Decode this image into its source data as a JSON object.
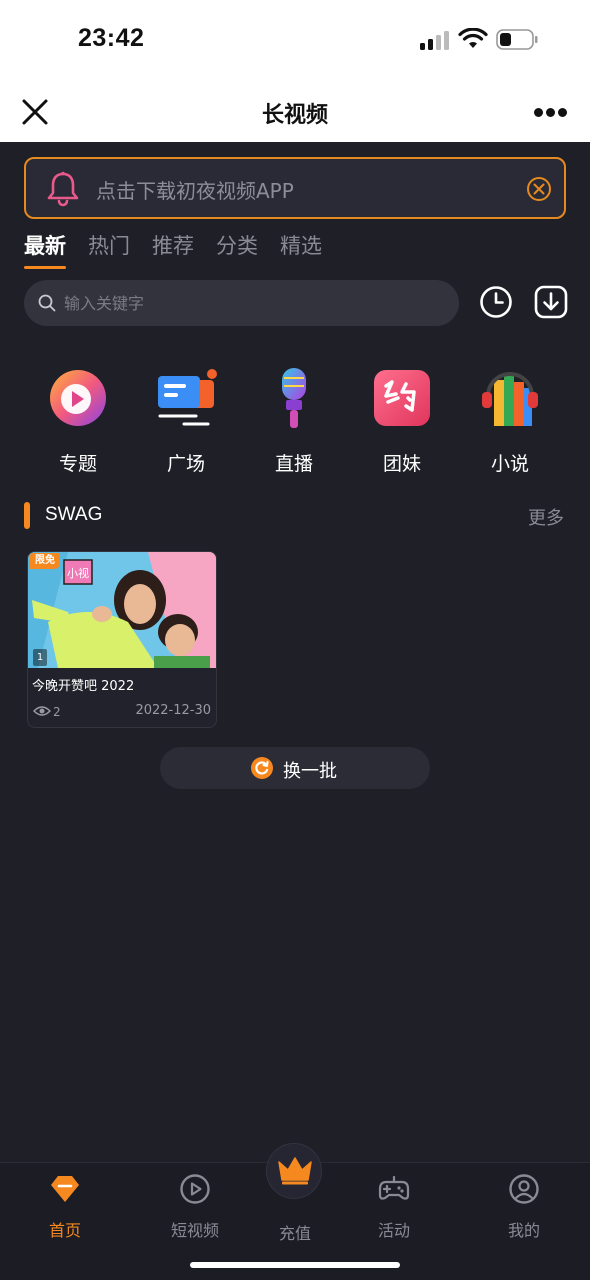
{
  "status_bar": {
    "time": "23:42"
  },
  "navbar": {
    "title": "长视频"
  },
  "banner": {
    "text": "点击下载初夜视频APP"
  },
  "tabs": [
    {
      "label": "最新",
      "active": true
    },
    {
      "label": "热门",
      "active": false
    },
    {
      "label": "推荐",
      "active": false
    },
    {
      "label": "分类",
      "active": false
    },
    {
      "label": "精选",
      "active": false
    }
  ],
  "search": {
    "placeholder": "输入关键字"
  },
  "categories": [
    {
      "label": "专题",
      "icon": "topic-icon"
    },
    {
      "label": "广场",
      "icon": "square-icon"
    },
    {
      "label": "直播",
      "icon": "microphone-icon"
    },
    {
      "label": "团妹",
      "icon": "yue-icon"
    },
    {
      "label": "小说",
      "icon": "books-icon"
    }
  ],
  "section": {
    "title": "SWAG",
    "more": "更多"
  },
  "videos": [
    {
      "badge": "限免",
      "thumb_tag": "小视",
      "episode": "1",
      "title": "今晚开赞吧 2022",
      "views": "2",
      "date": "2022-12-30"
    }
  ],
  "refresh": {
    "label": "换一批"
  },
  "tabbar": [
    {
      "label": "首页",
      "icon": "home-icon",
      "active": true
    },
    {
      "label": "短视频",
      "icon": "play-circle-icon",
      "active": false
    },
    {
      "label": "充值",
      "icon": "crown-icon",
      "active": false
    },
    {
      "label": "活动",
      "icon": "gamepad-icon",
      "active": false
    },
    {
      "label": "我的",
      "icon": "user-icon",
      "active": false
    }
  ],
  "colors": {
    "accent": "#f5891f",
    "background": "#1f1f28",
    "banner_border": "#e48a1f"
  }
}
